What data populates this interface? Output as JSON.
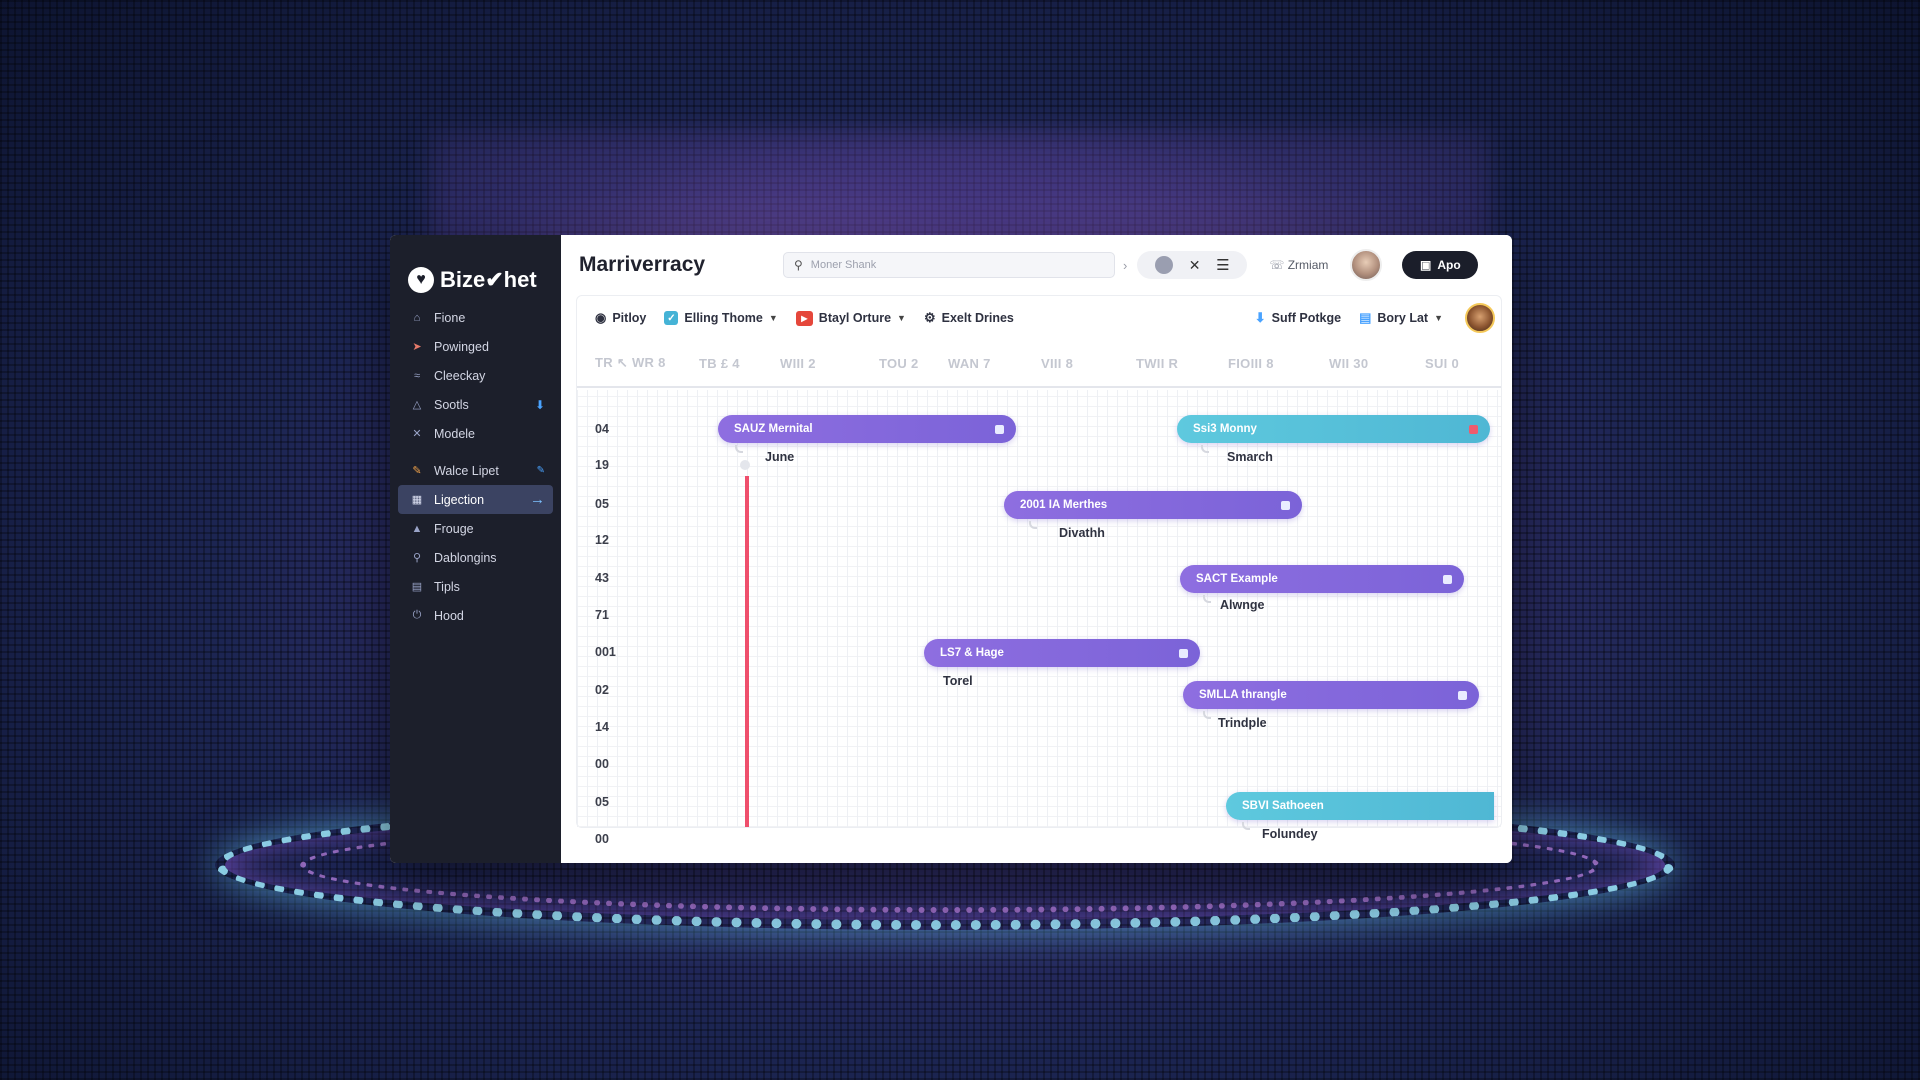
{
  "app": {
    "brand": "Bize✔het",
    "title": "Marriverracy"
  },
  "sidebar": {
    "items": [
      {
        "label": "Fione",
        "icon": "home-icon"
      },
      {
        "label": "Powinged",
        "icon": "rocket-icon"
      },
      {
        "label": "Cleeckay",
        "icon": "chart-icon"
      },
      {
        "label": "Sootls",
        "icon": "bell-icon"
      },
      {
        "label": "Modele",
        "icon": "cross-icon"
      },
      {
        "label": "Walce Lipet",
        "icon": "pencil-icon"
      },
      {
        "label": "Ligection",
        "icon": "document-icon"
      },
      {
        "label": "Frouge",
        "icon": "bag-icon"
      },
      {
        "label": "Dablongins",
        "icon": "pin-icon"
      },
      {
        "label": "Tipls",
        "icon": "book-icon"
      },
      {
        "label": "Hood",
        "icon": "power-icon"
      }
    ]
  },
  "header": {
    "search_placeholder": "Moner Shank",
    "user_name": "Zrmiam",
    "app_button": "Apo"
  },
  "toolbar": {
    "items": [
      {
        "label": "Pitloy"
      },
      {
        "label": "Elling Thome"
      },
      {
        "label": "Btayl Orture"
      },
      {
        "label": "Exelt Drines"
      }
    ],
    "right": [
      {
        "label": "Suff Potkge"
      },
      {
        "label": "Bory Lat"
      }
    ]
  },
  "timeline": {
    "columns": [
      "TR ↖ WR 8",
      "TB £ 4",
      "WIII 2",
      "TOU 2",
      "WAN 7",
      "VIII 8",
      "TWII R",
      "FIOIII 8",
      "WII 30",
      "SUI 0"
    ],
    "rows": [
      "04",
      "19",
      "05",
      "12",
      "43",
      "71",
      "001",
      "02",
      "14",
      "00",
      "05",
      "00"
    ],
    "tasks": [
      {
        "label": "SAUZ Mernital",
        "sub": "June",
        "color": "purple"
      },
      {
        "label": "Ssi3 Monny",
        "sub": "Smarch",
        "color": "teal"
      },
      {
        "label": "2001 IA Merthes",
        "sub": "Divathh",
        "color": "purple"
      },
      {
        "label": "SACT Example",
        "sub": "Alwnge",
        "color": "purple"
      },
      {
        "label": "LS7 & Hage",
        "sub": "Torel",
        "color": "purple"
      },
      {
        "label": "SMLLA thrangle",
        "sub": "Trindple",
        "color": "purple"
      },
      {
        "label": "SBVI Sathoeen",
        "sub": "Folundey",
        "color": "teal"
      }
    ]
  },
  "colors": {
    "sidebar_bg": "#1c1f2b",
    "purple_bar": "#7b63d8",
    "teal_bar": "#4fb7d4",
    "today_line": "#ef4f6c"
  }
}
